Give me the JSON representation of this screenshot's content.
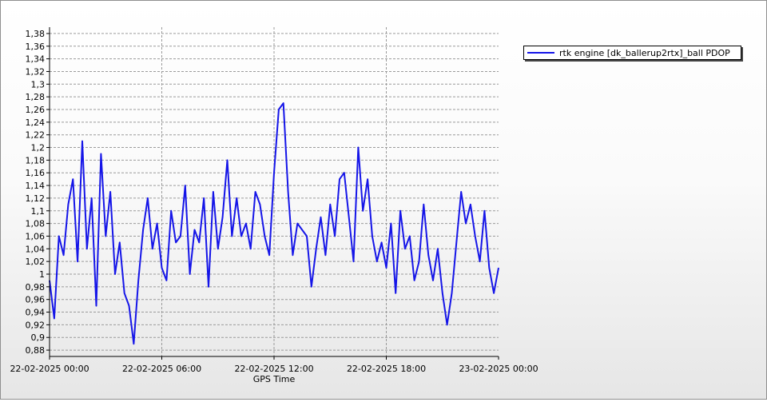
{
  "chart_data": {
    "type": "line",
    "xlabel": "GPS Time",
    "ylabel": "",
    "xticks": [
      "22-02-2025 00:00",
      "22-02-2025 06:00",
      "22-02-2025 12:00",
      "22-02-2025 18:00",
      "23-02-2025 00:00"
    ],
    "xlim": [
      "22-02-2025 00:00",
      "23-02-2025 00:00"
    ],
    "ylim": [
      0.87,
      1.39
    ],
    "yticks": [
      "0,88",
      "0,9",
      "0,92",
      "0,94",
      "0,96",
      "0,98",
      "1",
      "1,02",
      "1,04",
      "1,06",
      "1,08",
      "1,1",
      "1,12",
      "1,14",
      "1,16",
      "1,18",
      "1,2",
      "1,22",
      "1,24",
      "1,26",
      "1,28",
      "1,3",
      "1,32",
      "1,34",
      "1,36",
      "1,38"
    ],
    "grid": true,
    "legend_position": "top-right",
    "series": [
      {
        "name": "rtk engine [dk_ballerup2rtx]_ball PDOP",
        "color": "#1515e8",
        "x_hours": [
          0,
          0.25,
          0.5,
          0.75,
          1,
          1.25,
          1.5,
          1.75,
          2,
          2.25,
          2.5,
          2.75,
          3,
          3.25,
          3.5,
          3.75,
          4,
          4.25,
          4.5,
          4.75,
          5,
          5.25,
          5.5,
          5.75,
          6,
          6.25,
          6.5,
          6.75,
          7,
          7.25,
          7.5,
          7.75,
          8,
          8.25,
          8.5,
          8.75,
          9,
          9.25,
          9.5,
          9.75,
          10,
          10.25,
          10.5,
          10.75,
          11,
          11.25,
          11.5,
          11.75,
          12,
          12.25,
          12.5,
          12.75,
          13,
          13.25,
          13.5,
          13.75,
          14,
          14.25,
          14.5,
          14.75,
          15,
          15.25,
          15.5,
          15.75,
          16,
          16.25,
          16.5,
          16.75,
          17,
          17.25,
          17.5,
          17.75,
          18,
          18.25,
          18.5,
          18.75,
          19,
          19.25,
          19.5,
          19.75,
          20,
          20.25,
          20.5,
          20.75,
          21,
          21.25,
          21.5,
          21.75,
          22,
          22.25,
          22.5,
          22.75,
          23,
          23.25,
          23.5,
          23.75,
          24
        ],
        "values": [
          0.99,
          0.93,
          1.06,
          1.03,
          1.11,
          1.15,
          1.02,
          1.21,
          1.04,
          1.12,
          0.95,
          1.19,
          1.06,
          1.13,
          1.0,
          1.05,
          0.97,
          0.95,
          0.89,
          0.99,
          1.07,
          1.12,
          1.04,
          1.08,
          1.01,
          0.99,
          1.1,
          1.05,
          1.06,
          1.14,
          1.0,
          1.07,
          1.05,
          1.12,
          0.98,
          1.13,
          1.04,
          1.09,
          1.18,
          1.06,
          1.12,
          1.06,
          1.08,
          1.04,
          1.13,
          1.11,
          1.06,
          1.03,
          1.16,
          1.26,
          1.27,
          1.13,
          1.03,
          1.08,
          1.07,
          1.06,
          0.98,
          1.04,
          1.09,
          1.03,
          1.11,
          1.06,
          1.15,
          1.16,
          1.09,
          1.02,
          1.2,
          1.1,
          1.15,
          1.06,
          1.02,
          1.05,
          1.01,
          1.08,
          0.97,
          1.1,
          1.04,
          1.06,
          0.99,
          1.02,
          1.11,
          1.03,
          0.99,
          1.04,
          0.97,
          0.92,
          0.97,
          1.05,
          1.13,
          1.08,
          1.11,
          1.06,
          1.02,
          1.1,
          1.01,
          0.97,
          1.01
        ]
      }
    ]
  }
}
